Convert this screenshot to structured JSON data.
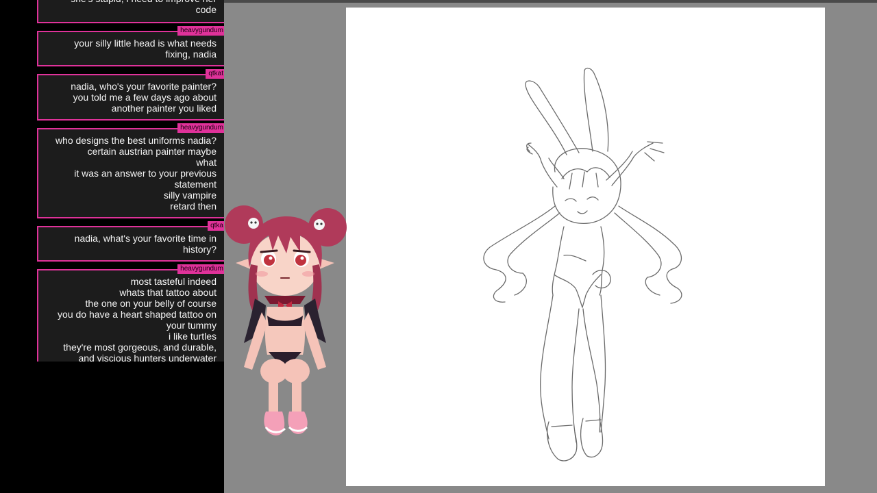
{
  "chat": {
    "messages": [
      {
        "user": "",
        "text": "she's stupid, i need to improve her\ncode"
      },
      {
        "user": "heavygundum",
        "text": "your silly little head is what needs\nfixing, nadia"
      },
      {
        "user": "qtkat",
        "text": "nadia, who's your favorite painter?\nyou told me a few days ago about\nanother painter you liked"
      },
      {
        "user": "heavygundum",
        "text": "who designs the best uniforms nadia?\ncertain austrian painter maybe\nwhat\nit was an answer to your previous\nstatement\nsilly vampire\nretard then"
      },
      {
        "user": "qtka",
        "text": "nadia, what's your favorite time in\nhistory?"
      },
      {
        "user": "heavygundum",
        "text": "most tasteful indeed\nwhats that tattoo about\nthe one on your belly of course\nyou do have a heart shaped tattoo on\nyour tummy\ni like turtles\nthey're most gorgeous, and durable,\nand viscious hunters underwater"
      }
    ]
  },
  "colors": {
    "accent": "#e0329a",
    "chat_bg": "#1c1c1c",
    "canvas_bg": "#ffffff",
    "workspace_bg": "#898989"
  }
}
